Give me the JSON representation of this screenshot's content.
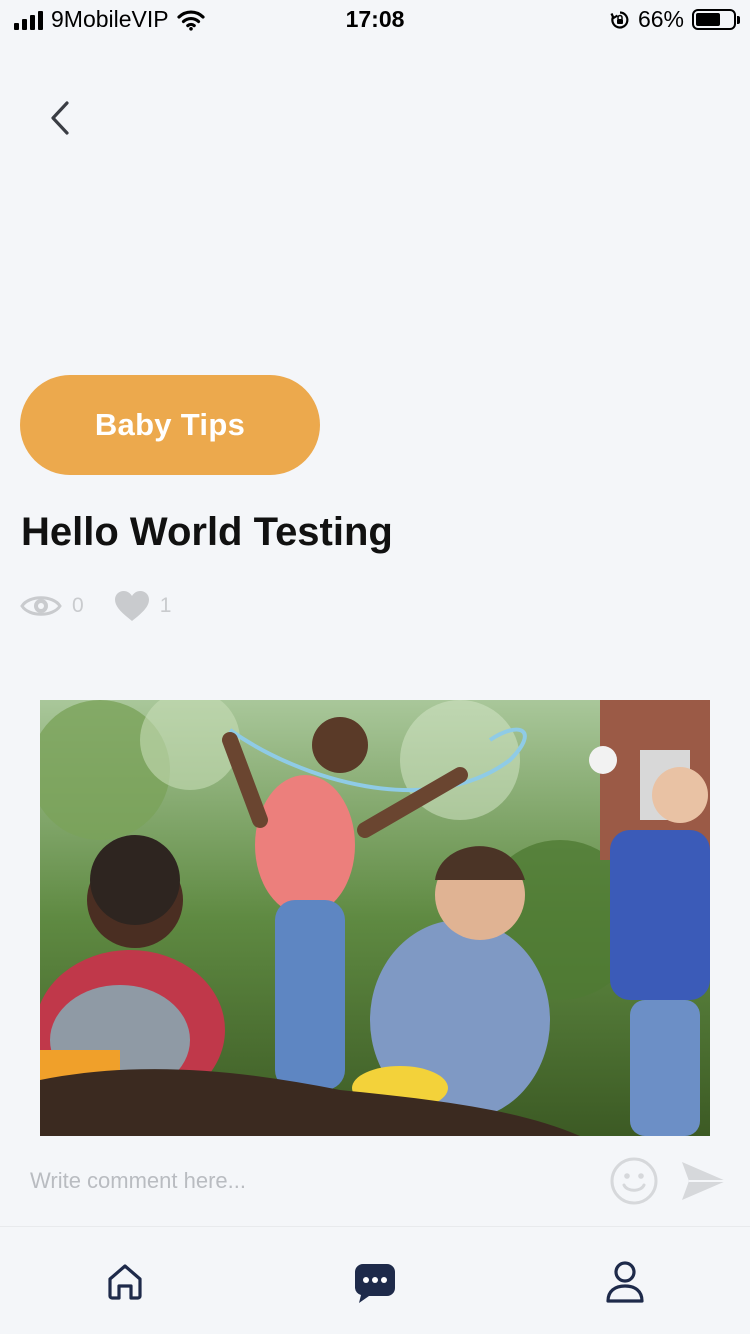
{
  "status_bar": {
    "carrier": "9MobileVIP",
    "time": "17:08",
    "battery_percent": "66%",
    "battery_level": 0.66
  },
  "post": {
    "category": "Baby Tips",
    "title": "Hello World Testing",
    "views": "0",
    "likes": "1"
  },
  "comment": {
    "placeholder": "Write comment here..."
  },
  "colors": {
    "background": "#f4f6f9",
    "category_pill": "#eca94d",
    "nav_icon": "#1e2a4a",
    "muted_icon": "#c9cbce"
  },
  "icons": {
    "back": "chevron-left-icon",
    "views": "eye-icon",
    "likes": "heart-icon",
    "emoji": "smiley-icon",
    "send": "send-icon",
    "tab_home": "home-icon",
    "tab_chat": "chat-bubble-icon",
    "tab_profile": "user-icon"
  }
}
